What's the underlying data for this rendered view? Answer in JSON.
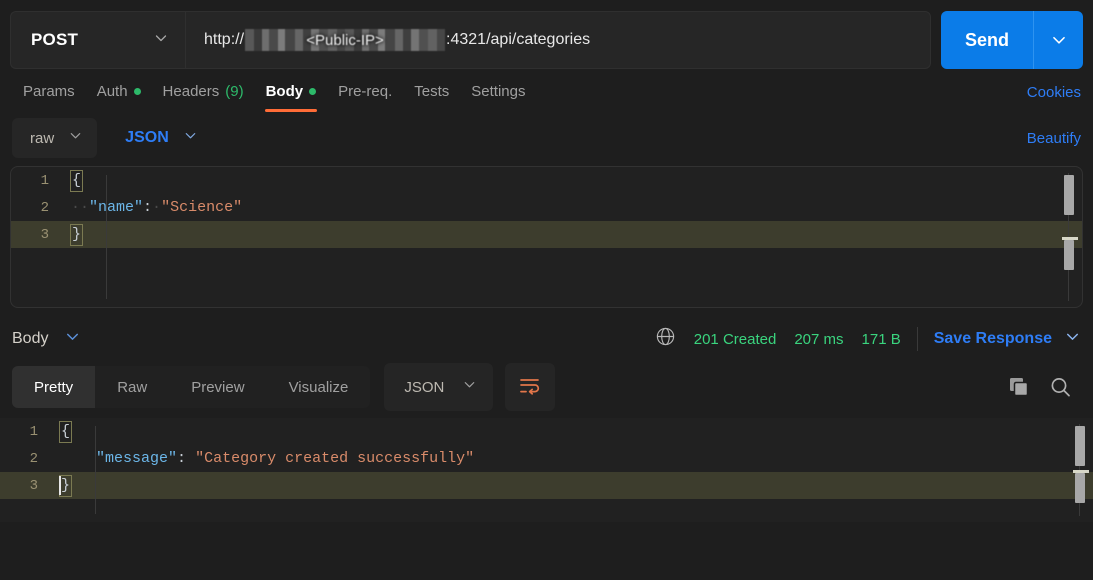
{
  "request": {
    "method": "POST",
    "method_caret_icon": "chevron-down-icon",
    "url": {
      "scheme_prefix": "http://",
      "redacted_label": "<Public-IP>",
      "suffix": ":4321/api/categories",
      "full": "http://<Public-IP>:4321/api/categories"
    },
    "send_label": "Send",
    "send_caret_icon": "chevron-down-icon",
    "tabs": [
      {
        "label": "Params",
        "active": false,
        "dot": false,
        "count": null
      },
      {
        "label": "Auth",
        "active": false,
        "dot": true,
        "count": null
      },
      {
        "label": "Headers",
        "active": false,
        "dot": false,
        "count": "(9)"
      },
      {
        "label": "Body",
        "active": true,
        "dot": true,
        "count": null
      },
      {
        "label": "Pre-req.",
        "active": false,
        "dot": false,
        "count": null
      },
      {
        "label": "Tests",
        "active": false,
        "dot": false,
        "count": null
      },
      {
        "label": "Settings",
        "active": false,
        "dot": false,
        "count": null
      }
    ],
    "cookies_label": "Cookies",
    "body_mode": "raw",
    "body_format": "JSON",
    "beautify_label": "Beautify",
    "body_code": {
      "lines": [
        {
          "n": "1",
          "tokens": [
            {
              "t": "brace",
              "v": "{"
            }
          ],
          "highlight": false
        },
        {
          "n": "2",
          "tokens": [
            {
              "t": "dots",
              "v": "··"
            },
            {
              "t": "key",
              "v": "\"name\""
            },
            {
              "t": "punct",
              "v": ":"
            },
            {
              "t": "dots",
              "v": "·"
            },
            {
              "t": "str",
              "v": "\"Science\""
            }
          ],
          "highlight": false
        },
        {
          "n": "3",
          "tokens": [
            {
              "t": "brace",
              "v": "}"
            }
          ],
          "highlight": true
        }
      ]
    }
  },
  "response": {
    "body_label": "Body",
    "body_caret_icon": "chevron-down-icon",
    "globe_icon": "globe-icon",
    "status": "201 Created",
    "time": "207 ms",
    "size": "171 B",
    "save_response_label": "Save Response",
    "save_caret_icon": "chevron-down-icon",
    "tabs": [
      {
        "label": "Pretty",
        "active": true
      },
      {
        "label": "Raw",
        "active": false
      },
      {
        "label": "Preview",
        "active": false
      },
      {
        "label": "Visualize",
        "active": false
      }
    ],
    "format": "JSON",
    "format_caret_icon": "chevron-down-icon",
    "wrap_icon": "word-wrap-icon",
    "copy_icon": "copy-icon",
    "search_icon": "search-icon",
    "body_code": {
      "lines": [
        {
          "n": "1",
          "tokens": [
            {
              "t": "brace",
              "v": "{"
            }
          ],
          "highlight": false
        },
        {
          "n": "2",
          "tokens": [
            {
              "t": "plain",
              "v": "    "
            },
            {
              "t": "key",
              "v": "\"message\""
            },
            {
              "t": "punct",
              "v": ":"
            },
            {
              "t": "plain",
              "v": " "
            },
            {
              "t": "str",
              "v": "\"Category created successfully\""
            }
          ],
          "highlight": false
        },
        {
          "n": "3",
          "tokens": [
            {
              "t": "brace",
              "v": "}"
            }
          ],
          "highlight": true
        }
      ]
    }
  },
  "colors": {
    "accent_orange": "#ff6c37",
    "link_blue": "#2e7df6",
    "send_blue": "#0b7ce8",
    "status_green": "#3ad47e",
    "dot_green": "#2dba6a",
    "json_key": "#6cb6e8",
    "json_string": "#d98b6a",
    "app_bg": "#1e1e1e",
    "panel_bg": "#262626",
    "highlight_line": "#3d3d2d"
  }
}
